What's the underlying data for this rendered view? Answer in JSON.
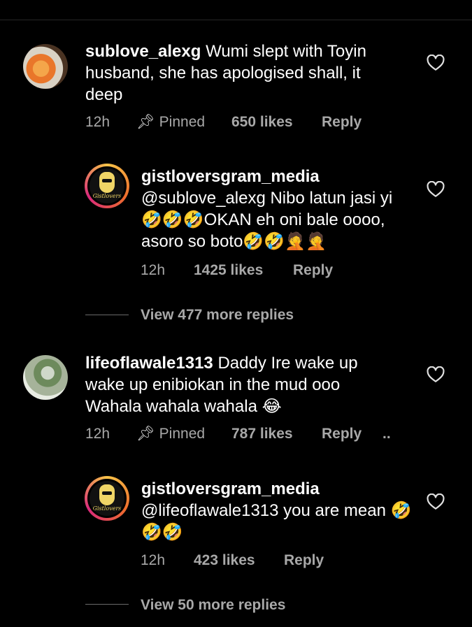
{
  "comments": [
    {
      "username": "sublove_alexg",
      "text": "Wumi slept with Toyin husband, she has apologised shall, it deep",
      "time": "12h",
      "pinned_label": "Pinned",
      "likes": "650 likes",
      "reply_label": "Reply",
      "avatar_icon": "food-avatar",
      "reply": {
        "username": "gistloversgram_media",
        "text": "@sublove_alexg Nibo latun jasi yi🤣🤣🤣OKAN eh oni bale oooo, asoro so boto🤣🤣🤦🤦",
        "time": "12h",
        "likes": "1425 likes",
        "reply_label": "Reply",
        "avatar_logo_text": "Gistlovers"
      },
      "view_more": "View 477 more replies"
    },
    {
      "username": "lifeoflawale1313",
      "text": "Daddy Ire wake up wake up enibiokan in the mud ooo Wahala wahala wahala 😂",
      "time": "12h",
      "pinned_label": "Pinned",
      "likes": "787 likes",
      "reply_label": "Reply",
      "more": "..",
      "avatar_icon": "person-avatar",
      "reply": {
        "username": "gistloversgram_media",
        "text": "@lifeoflawale1313 you are mean 🤣🤣🤣",
        "time": "12h",
        "likes": "423 likes",
        "reply_label": "Reply",
        "avatar_logo_text": "Gistlovers"
      },
      "view_more": "View 50 more replies"
    }
  ],
  "colors": {
    "background": "#000000",
    "text": "#ffffff",
    "meta": "#a8a8a8"
  }
}
